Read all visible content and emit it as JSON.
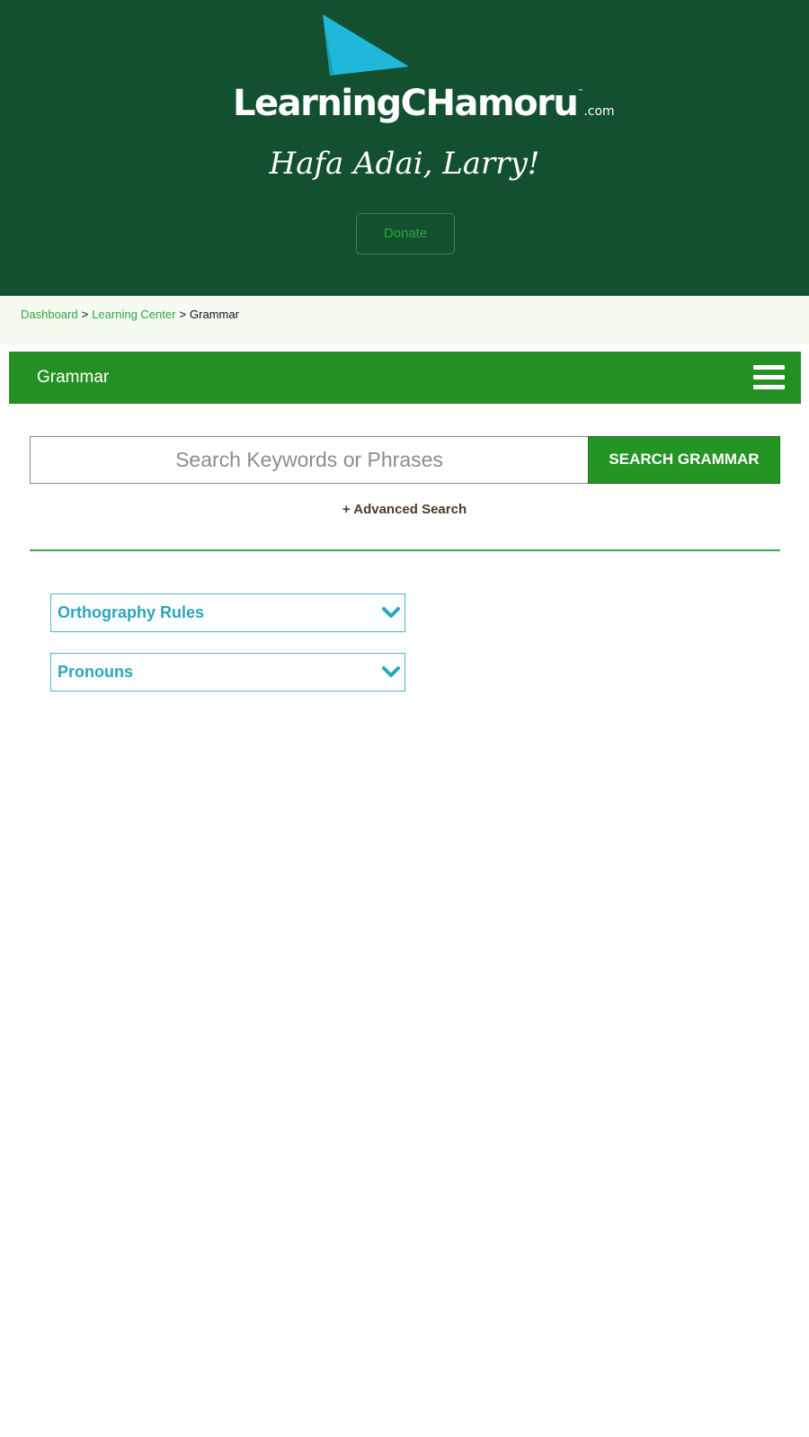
{
  "header": {
    "logo": {
      "text_main": "LearningCHamoru",
      "text_tm": "™",
      "text_tld": ".com",
      "sail_color": "#1fb8d8"
    },
    "greeting": "Hafa Adai, Larry!",
    "donate_label": "Donate",
    "background_color": "#135030"
  },
  "breadcrumb": {
    "items": [
      {
        "label": "Dashboard",
        "link": true
      },
      {
        "label": "Learning Center",
        "link": true
      },
      {
        "label": "Grammar",
        "link": false
      }
    ],
    "separator": ">"
  },
  "title_bar": {
    "title": "Grammar",
    "menu_icon": "hamburger-menu-icon",
    "background_color": "#249024"
  },
  "search": {
    "placeholder": "Search Keywords or Phrases",
    "value": "",
    "button_label": "SEARCH GRAMMAR",
    "advanced_label": "+ Advanced Search"
  },
  "sections": [
    {
      "label": "Orthography Rules",
      "icon": "chevron-down-icon"
    },
    {
      "label": "Pronouns",
      "icon": "chevron-down-icon"
    }
  ],
  "colors": {
    "accent_green": "#2fa33f",
    "accordion_teal": "#2aa6bd"
  }
}
